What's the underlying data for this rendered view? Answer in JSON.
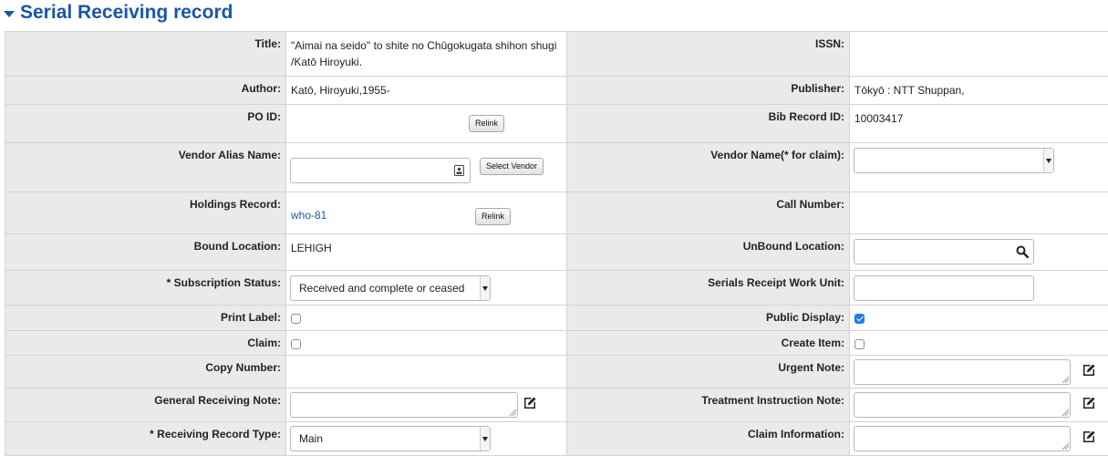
{
  "header": {
    "title": "Serial Receiving record"
  },
  "fields": {
    "title": {
      "label": "Title:",
      "value": "\"Aimai na seido\" to shite no Chūgokugata shihon shugi /Katō Hiroyuki."
    },
    "issn": {
      "label": "ISSN:",
      "value": ""
    },
    "author": {
      "label": "Author:",
      "value": "Katō, Hiroyuki,1955-"
    },
    "publisher": {
      "label": "Publisher:",
      "value": "Tōkyō : NTT Shuppan,"
    },
    "po_id": {
      "label": "PO ID:",
      "value": "",
      "button": "Relink"
    },
    "bib_record_id": {
      "label": "Bib Record ID:",
      "value": "10003417"
    },
    "vendor_alias": {
      "label": "Vendor Alias Name:",
      "value": "",
      "button": "Select Vendor"
    },
    "vendor_name": {
      "label": "Vendor Name(* for claim):",
      "value": ""
    },
    "holdings_record": {
      "label": "Holdings Record:",
      "value": "who-81",
      "button": "Relink"
    },
    "call_number": {
      "label": "Call Number:",
      "value": ""
    },
    "bound_location": {
      "label": "Bound Location:",
      "value": "LEHIGH"
    },
    "unbound_location": {
      "label": "UnBound Location:",
      "value": ""
    },
    "subscription_status": {
      "label": "* Subscription Status:",
      "value": "Received and complete or ceased"
    },
    "receipt_work_unit": {
      "label": "Serials Receipt Work Unit:",
      "value": ""
    },
    "print_label": {
      "label": "Print Label:",
      "checked": false
    },
    "public_display": {
      "label": "Public Display:",
      "checked": true
    },
    "claim": {
      "label": "Claim:",
      "checked": false
    },
    "create_item": {
      "label": "Create Item:",
      "checked": false
    },
    "copy_number": {
      "label": "Copy Number:",
      "value": ""
    },
    "urgent_note": {
      "label": "Urgent Note:",
      "value": ""
    },
    "general_receiving_note": {
      "label": "General Receiving Note:",
      "value": ""
    },
    "treatment_instruction_note": {
      "label": "Treatment Instruction Note:",
      "value": ""
    },
    "receiving_record_type": {
      "label": "* Receiving Record Type:",
      "value": "Main"
    },
    "claim_information": {
      "label": "Claim Information:",
      "value": ""
    }
  },
  "icons": {
    "search": "search-icon",
    "edit": "edit-icon",
    "contact_card": "contact-card-icon"
  },
  "colors": {
    "accent": "#1a56a8",
    "checkbox_on": "#1e7bea",
    "label_bg": "#eaeaea"
  }
}
